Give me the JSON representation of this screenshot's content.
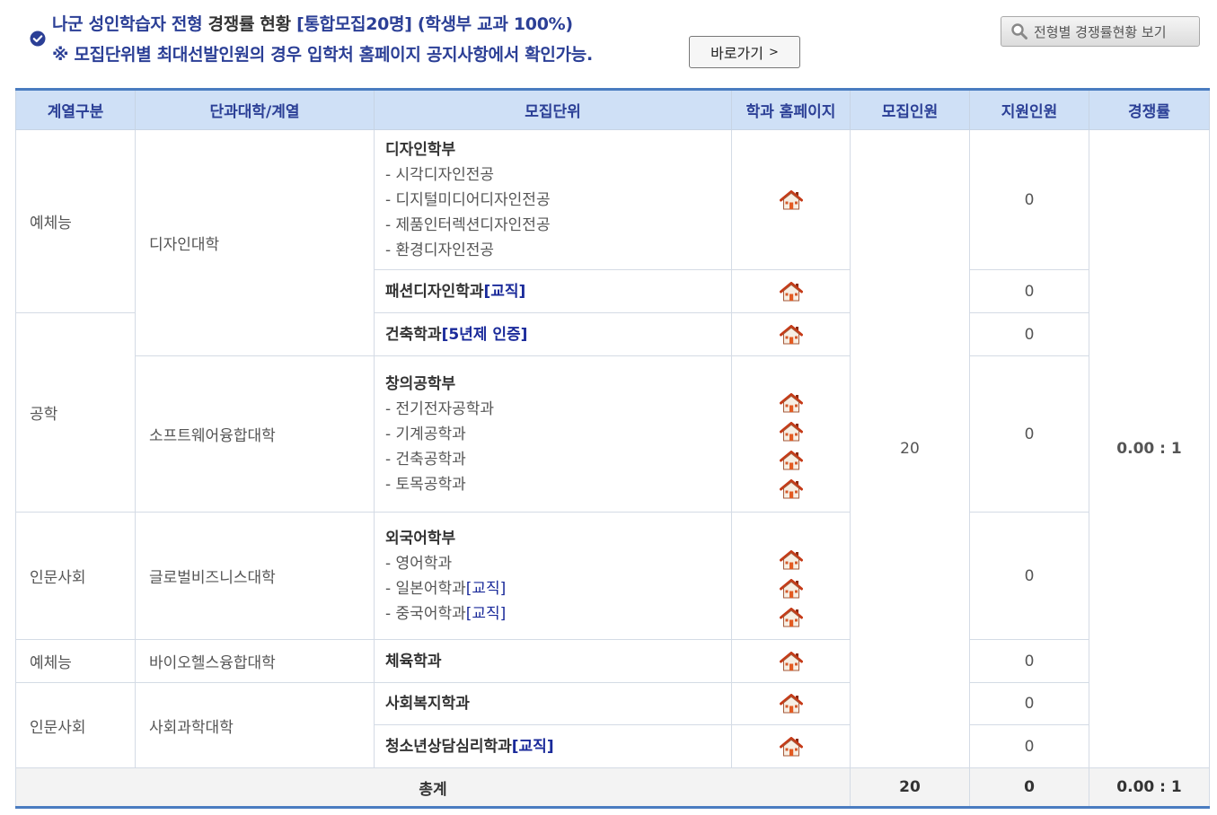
{
  "header": {
    "title_part1": "나군 성인학습자 전형 ",
    "title_part2": "경쟁률 현황",
    "title_part3": " [통합모집20명] (학생부 교과 100%)",
    "notice": "※ 모집단위별 최대선발인원의 경우 입학처 홈페이지 공지사항에서 확인가능.",
    "goto_label": "바로가기",
    "goto_arrow": ">",
    "view_label": "전형별 경쟁률현황 보기"
  },
  "table": {
    "headers": [
      "계열구분",
      "단과대학/계열",
      "모집단위",
      "학과 홈페이지",
      "모집인원",
      "지원인원",
      "경쟁률"
    ],
    "categories": [
      "예체능",
      "공학",
      "인문사회",
      "예체능",
      "인문사회"
    ],
    "colleges": [
      "디자인대학",
      "소프트웨어융합대학",
      "글로벌비즈니스대학",
      "바이오헬스융합대학",
      "사회과학대학"
    ],
    "units": [
      {
        "title": "디자인학부",
        "subs": [
          "- 시각디자인전공",
          "- 디지털미디어디자인전공",
          "- 제품인터렉션디자인전공",
          "- 환경디자인전공"
        ],
        "applicants": "0"
      },
      {
        "title": "패션디자인학과",
        "tag": "[교직]",
        "applicants": "0"
      },
      {
        "title": "건축학과",
        "tag": "[5년제 인증]",
        "applicants": "0"
      },
      {
        "title": "창의공학부",
        "subs": [
          "- 전기전자공학과",
          "- 기계공학과",
          "- 건축공학과",
          "- 토목공학과"
        ],
        "applicants": "0"
      },
      {
        "title": "외국어학부",
        "subs": [
          "- 영어학과",
          "- 일본어학과",
          "- 중국어학과"
        ],
        "sub_tag": "[교직]",
        "applicants": "0"
      },
      {
        "title": "체육학과",
        "applicants": "0"
      },
      {
        "title": "사회복지학과",
        "applicants": "0"
      },
      {
        "title": "청소년상담심리학과",
        "tag": "[교직]",
        "applicants": "0"
      }
    ],
    "quota": "20",
    "ratio": "0.00 : 1",
    "total": {
      "label": "총계",
      "quota": "20",
      "applicants": "0",
      "ratio": "0.00 : 1"
    }
  },
  "icons": {
    "check": "check-circle-icon",
    "search": "search-icon",
    "home": "home-icon"
  },
  "colors": {
    "accent": "#2b3f96",
    "header_bg": "#cfe0f6",
    "border_accent": "#4a7cc0",
    "tag": "#1a2a9a",
    "home_roof": "#d9451f"
  }
}
